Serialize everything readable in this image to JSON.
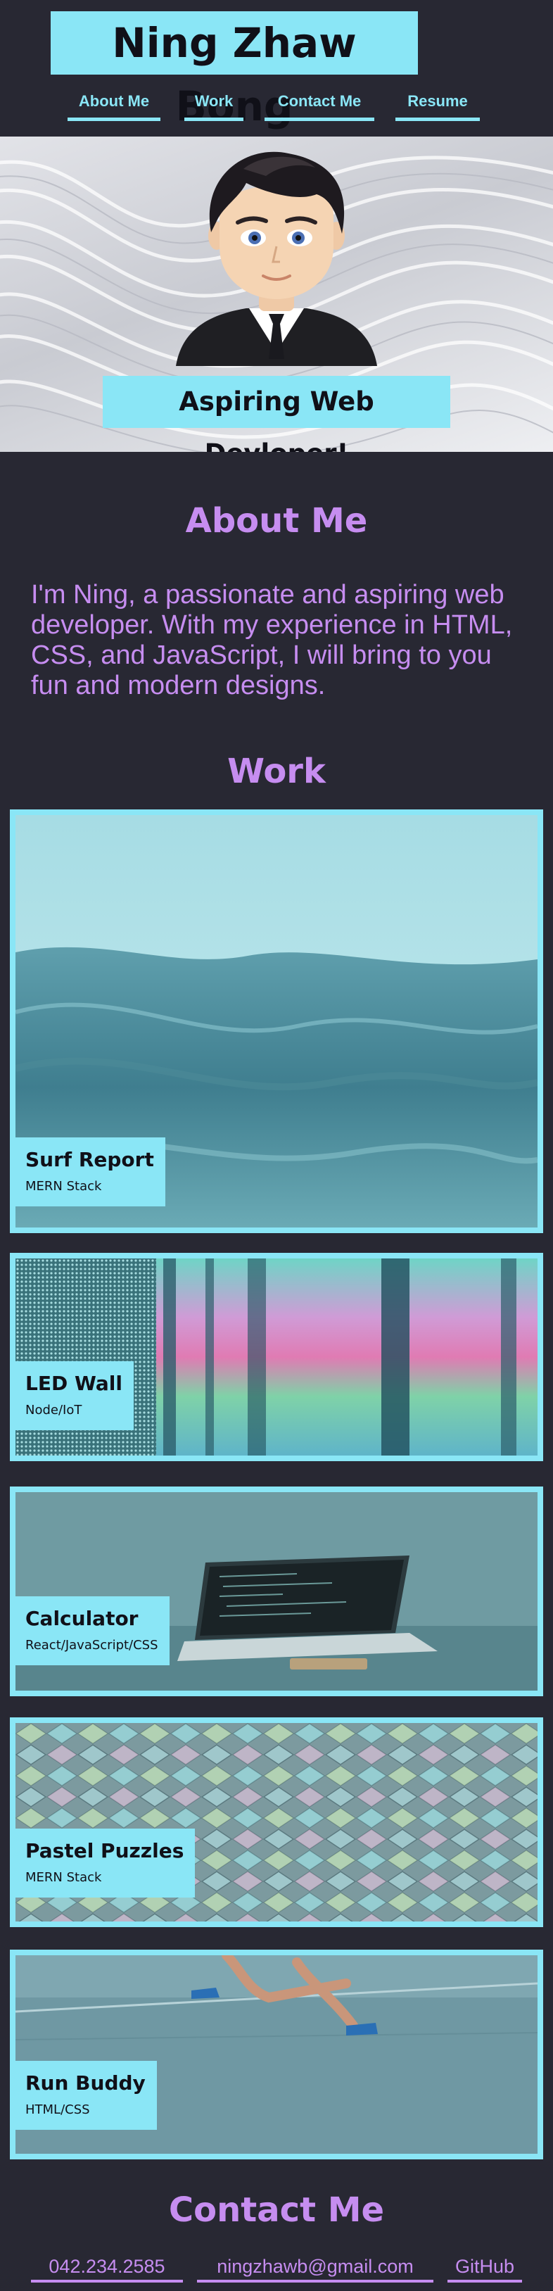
{
  "header": {
    "title": "Ning Zhaw Bong",
    "nav": [
      "About Me",
      "Work",
      "Contact Me",
      "Resume"
    ]
  },
  "hero": {
    "banner": "Aspiring Web Devloper!"
  },
  "about": {
    "heading": "About Me",
    "text": "I'm Ning, a passionate and aspiring web developer. With my experience in HTML, CSS, and JavaScript, I will bring to you fun and modern designs."
  },
  "work": {
    "heading": "Work",
    "projects": [
      {
        "title": "Surf Report",
        "stack": "MERN Stack"
      },
      {
        "title": "LED Wall",
        "stack": "Node/IoT"
      },
      {
        "title": "Calculator",
        "stack": "React/JavaScript/CSS"
      },
      {
        "title": "Pastel Puzzles",
        "stack": "MERN Stack"
      },
      {
        "title": "Run Buddy",
        "stack": "HTML/CSS"
      }
    ]
  },
  "contact": {
    "heading": "Contact Me",
    "links": [
      "042.234.2585",
      "ningzhawb@gmail.com",
      "GitHub"
    ]
  },
  "colors": {
    "background": "#282833",
    "accent_cyan": "#8ae6f6",
    "accent_purple": "#c68df0"
  }
}
